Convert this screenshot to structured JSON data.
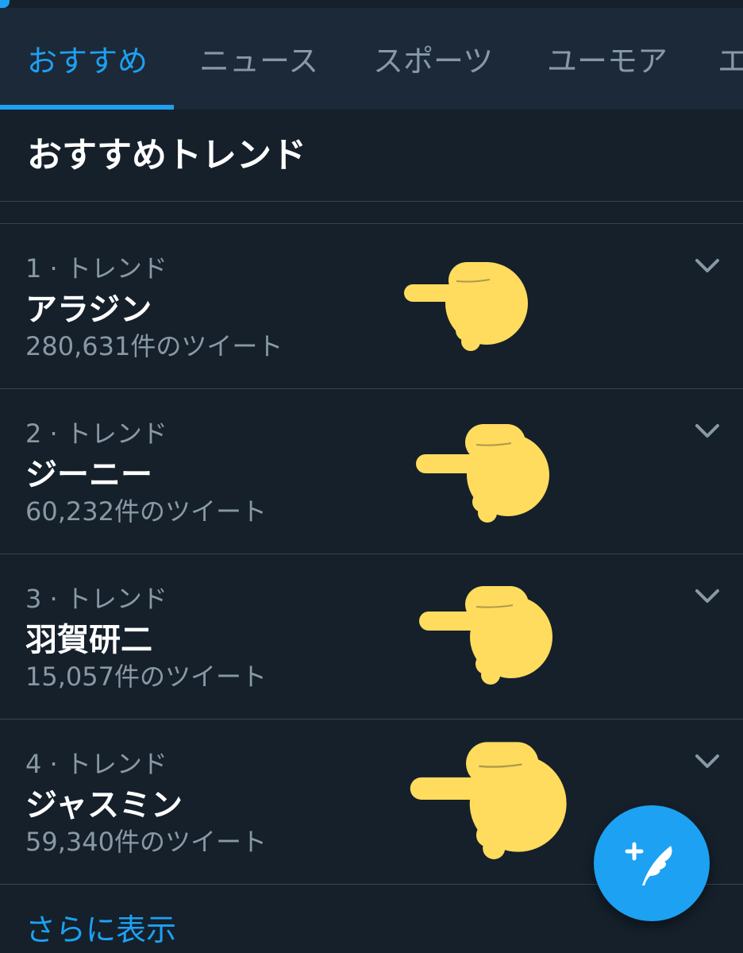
{
  "tabs": [
    {
      "label": "おすすめ",
      "active": true
    },
    {
      "label": "ニュース",
      "active": false
    },
    {
      "label": "スポーツ",
      "active": false
    },
    {
      "label": "ユーモア",
      "active": false
    },
    {
      "label": "エ",
      "active": false
    }
  ],
  "section": {
    "title": "おすすめトレンド"
  },
  "trends": [
    {
      "rank": "1 · トレンド",
      "name": "アラジン",
      "count": "280,631件のツイート"
    },
    {
      "rank": "2 · トレンド",
      "name": "ジーニー",
      "count": "60,232件のツイート"
    },
    {
      "rank": "3 · トレンド",
      "name": "羽賀研二",
      "count": "15,057件のツイート"
    },
    {
      "rank": "4 · トレンド",
      "name": "ジャスミン",
      "count": "59,340件のツイート"
    }
  ],
  "show_more": "さらに表示",
  "icons": {
    "chevron": "chevron-down-icon",
    "hand": "pointing-hand-icon",
    "compose": "compose-tweet-icon"
  },
  "colors": {
    "background": "#15202b",
    "tabbar": "#1c2938",
    "accent": "#1da1f2",
    "secondary_text": "#8899a6",
    "divider": "#38444d",
    "hand": "#ffdc5d"
  }
}
